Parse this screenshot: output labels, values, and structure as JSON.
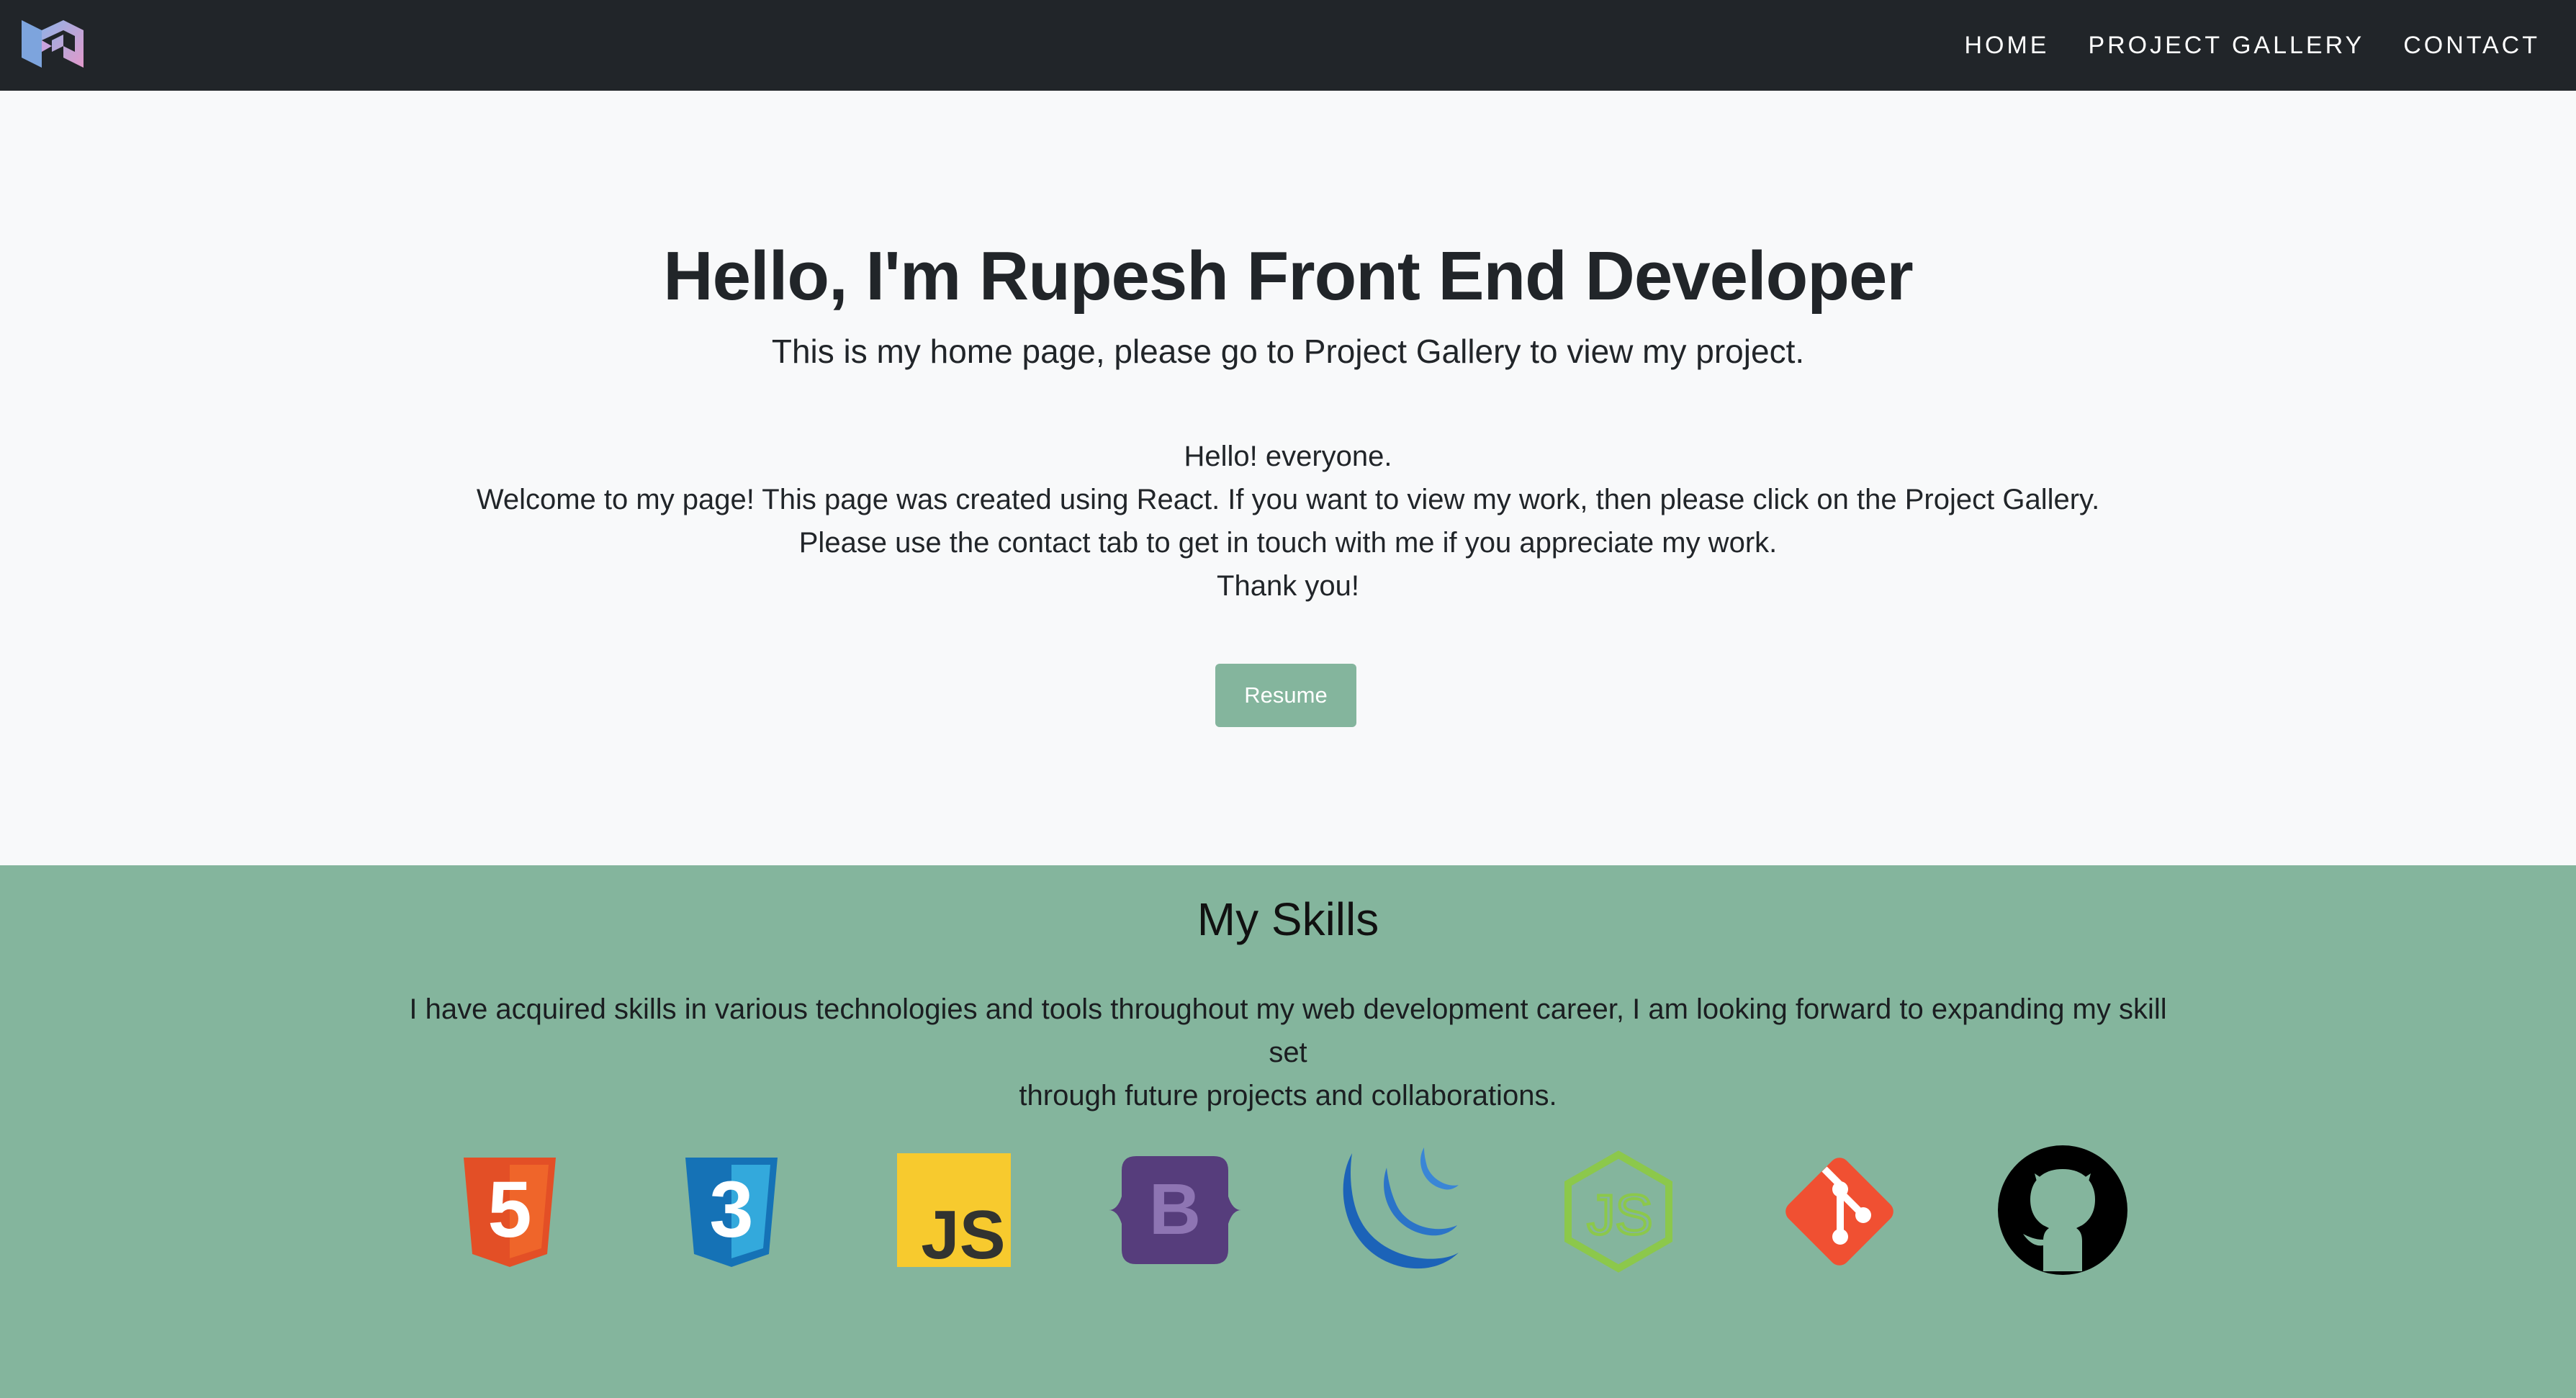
{
  "nav": {
    "logo_name": "logo-icon",
    "links": [
      "HOME",
      "PROJECT GALLERY",
      "CONTACT"
    ]
  },
  "hero": {
    "title": "Hello, I'm Rupesh Front End Developer",
    "subtitle": "This is my home page, please go to Project Gallery to view my project.",
    "intro_lines": [
      "Hello! everyone.",
      "Welcome to my page! This page was created using React. If you want to view my work, then please click on the Project Gallery.",
      "Please use the contact tab to get in touch with me if you appreciate my work.",
      "Thank you!"
    ],
    "resume_label": "Resume"
  },
  "skills": {
    "title": "My Skills",
    "description_lines": [
      "I have acquired skills in various technologies and tools throughout my web development career, I am looking forward to expanding my skill set",
      "through future projects and collaborations."
    ],
    "icons": [
      "html5-icon",
      "css3-icon",
      "javascript-icon",
      "bootstrap-icon",
      "jquery-icon",
      "nodejs-icon",
      "git-icon",
      "github-icon"
    ],
    "icon_glyphs": {
      "html5": "5",
      "css3": "3",
      "javascript": "JS",
      "bootstrap": "B",
      "nodejs": "JS"
    }
  },
  "colors": {
    "navbar": "#212529",
    "page_background": "#f8f9fa",
    "accent_green": "#84b59d",
    "html5": "#e34f26",
    "css3": "#1572b6",
    "javascript": "#f7df1e",
    "bootstrap": "#563d7c",
    "jquery": "#0769ad",
    "nodejs": "#8cc84b",
    "git": "#f05032",
    "github": "#000000"
  }
}
